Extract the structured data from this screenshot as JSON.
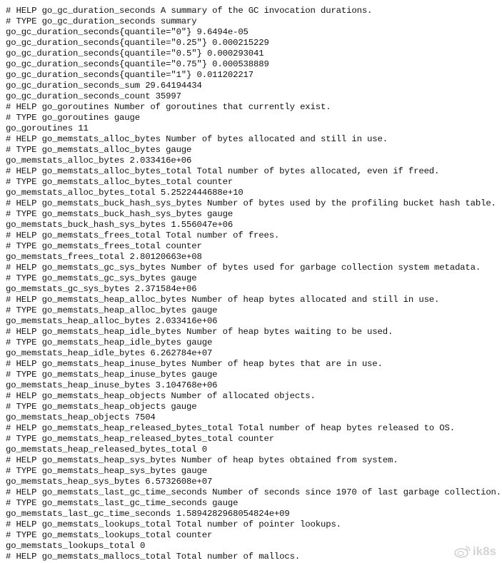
{
  "page": {
    "lines": [
      "# HELP go_gc_duration_seconds A summary of the GC invocation durations.",
      "# TYPE go_gc_duration_seconds summary",
      "go_gc_duration_seconds{quantile=\"0\"} 9.6494e-05",
      "go_gc_duration_seconds{quantile=\"0.25\"} 0.000215229",
      "go_gc_duration_seconds{quantile=\"0.5\"} 0.000293041",
      "go_gc_duration_seconds{quantile=\"0.75\"} 0.000538889",
      "go_gc_duration_seconds{quantile=\"1\"} 0.011202217",
      "go_gc_duration_seconds_sum 29.64194434",
      "go_gc_duration_seconds_count 35997",
      "# HELP go_goroutines Number of goroutines that currently exist.",
      "# TYPE go_goroutines gauge",
      "go_goroutines 11",
      "# HELP go_memstats_alloc_bytes Number of bytes allocated and still in use.",
      "# TYPE go_memstats_alloc_bytes gauge",
      "go_memstats_alloc_bytes 2.033416e+06",
      "# HELP go_memstats_alloc_bytes_total Total number of bytes allocated, even if freed.",
      "# TYPE go_memstats_alloc_bytes_total counter",
      "go_memstats_alloc_bytes_total 5.2522444688e+10",
      "# HELP go_memstats_buck_hash_sys_bytes Number of bytes used by the profiling bucket hash table.",
      "# TYPE go_memstats_buck_hash_sys_bytes gauge",
      "go_memstats_buck_hash_sys_bytes 1.556047e+06",
      "# HELP go_memstats_frees_total Total number of frees.",
      "# TYPE go_memstats_frees_total counter",
      "go_memstats_frees_total 2.80120663e+08",
      "# HELP go_memstats_gc_sys_bytes Number of bytes used for garbage collection system metadata.",
      "# TYPE go_memstats_gc_sys_bytes gauge",
      "go_memstats_gc_sys_bytes 2.371584e+06",
      "# HELP go_memstats_heap_alloc_bytes Number of heap bytes allocated and still in use.",
      "# TYPE go_memstats_heap_alloc_bytes gauge",
      "go_memstats_heap_alloc_bytes 2.033416e+06",
      "# HELP go_memstats_heap_idle_bytes Number of heap bytes waiting to be used.",
      "# TYPE go_memstats_heap_idle_bytes gauge",
      "go_memstats_heap_idle_bytes 6.262784e+07",
      "# HELP go_memstats_heap_inuse_bytes Number of heap bytes that are in use.",
      "# TYPE go_memstats_heap_inuse_bytes gauge",
      "go_memstats_heap_inuse_bytes 3.104768e+06",
      "# HELP go_memstats_heap_objects Number of allocated objects.",
      "# TYPE go_memstats_heap_objects gauge",
      "go_memstats_heap_objects 7504",
      "# HELP go_memstats_heap_released_bytes_total Total number of heap bytes released to OS.",
      "# TYPE go_memstats_heap_released_bytes_total counter",
      "go_memstats_heap_released_bytes_total 0",
      "# HELP go_memstats_heap_sys_bytes Number of heap bytes obtained from system.",
      "# TYPE go_memstats_heap_sys_bytes gauge",
      "go_memstats_heap_sys_bytes 6.5732608e+07",
      "# HELP go_memstats_last_gc_time_seconds Number of seconds since 1970 of last garbage collection.",
      "# TYPE go_memstats_last_gc_time_seconds gauge",
      "go_memstats_last_gc_time_seconds 1.5894282968054824e+09",
      "# HELP go_memstats_lookups_total Total number of pointer lookups.",
      "# TYPE go_memstats_lookups_total counter",
      "go_memstats_lookups_total 0",
      "# HELP go_memstats_mallocs_total Total number of mallocs."
    ]
  },
  "watermark": {
    "icon": "weibo-icon",
    "text": "ik8s"
  }
}
